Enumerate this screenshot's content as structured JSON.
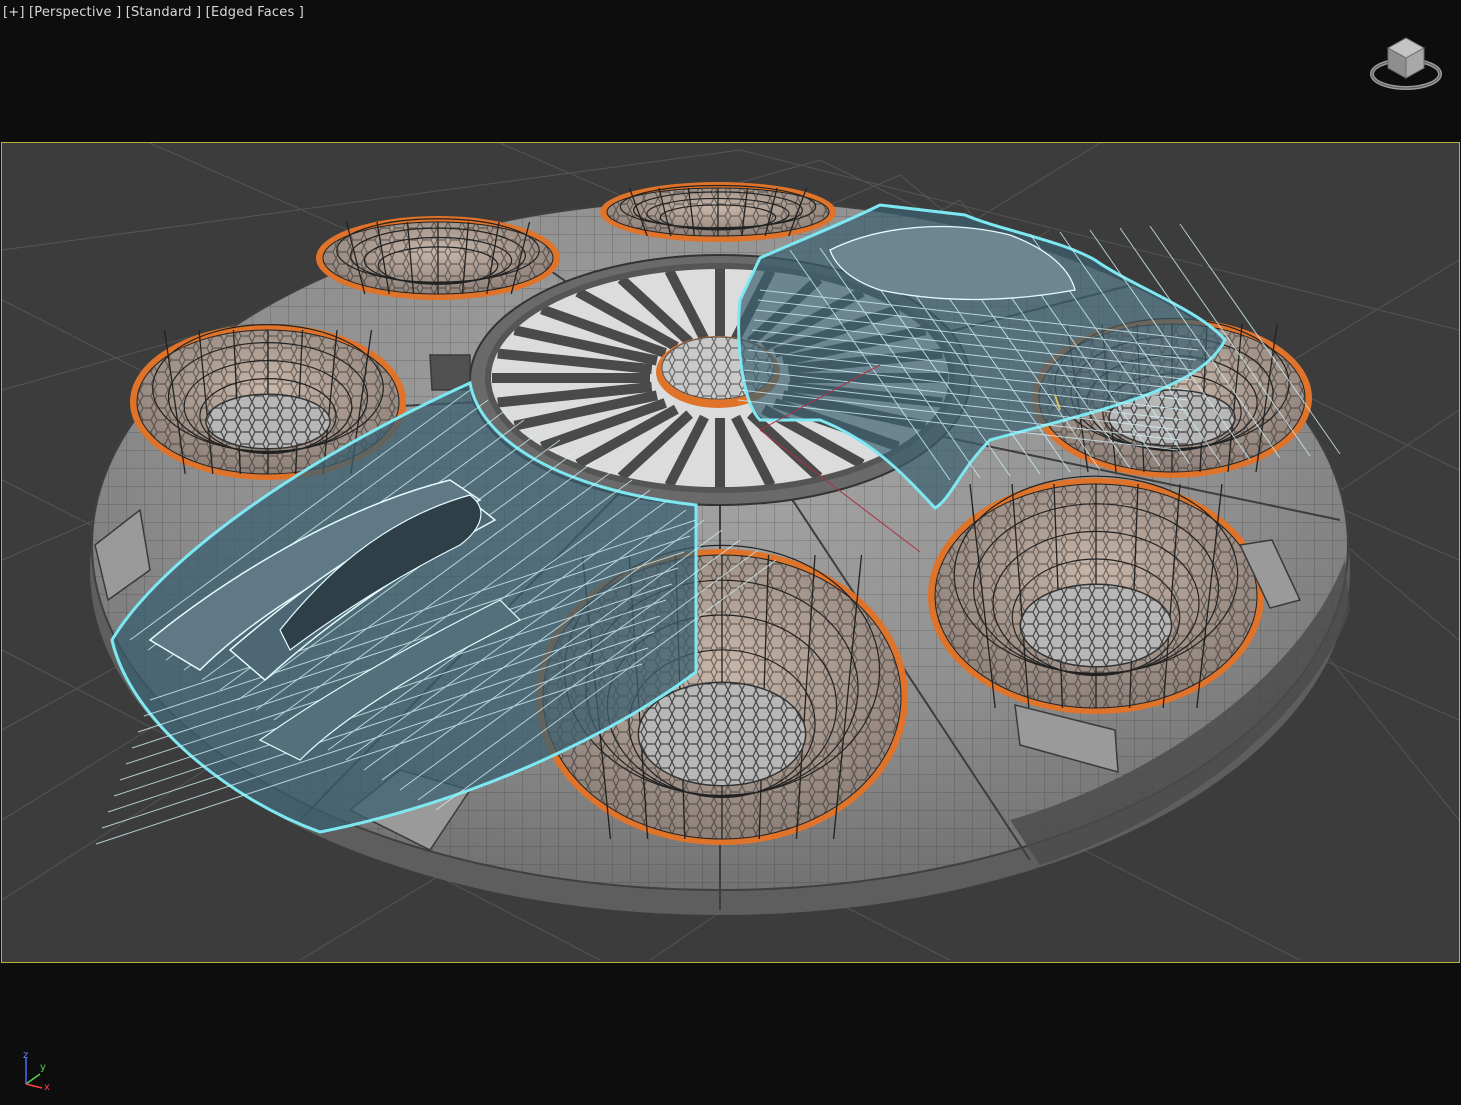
{
  "viewport": {
    "labels": [
      "[+]",
      "[Perspective ]",
      "[Standard ]",
      "[Edged Faces ]"
    ],
    "view_name": "Perspective",
    "shading": "Standard",
    "display_mode": "Edged Faces"
  },
  "colors": {
    "background": "#0d0d0d",
    "safe_frame": "#b7b23a",
    "hull": "#8a8a8a",
    "hull_dark": "#5c5c5c",
    "selection": "#7de8f2",
    "selection_fill": "#3b5f70",
    "orange_ring": "#e0732a",
    "grid": "#5a5a5a"
  },
  "axis_tripod": {
    "z": "z",
    "y": "y",
    "x": "x"
  },
  "icons": [
    "viewcube-icon",
    "axis-tripod-icon"
  ]
}
